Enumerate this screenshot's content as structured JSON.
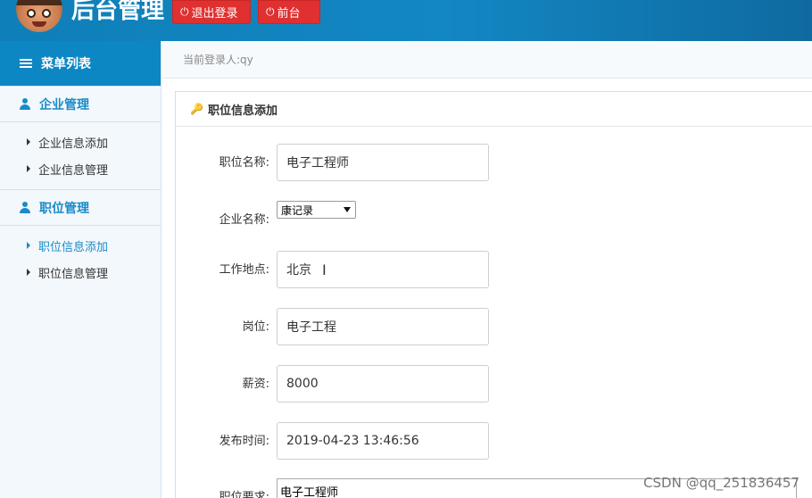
{
  "header": {
    "title": "后台管理",
    "logout_label": "退出登录",
    "front_label": "前台",
    "power_icon": "power-icon"
  },
  "sidebar": {
    "menu_title": "菜单列表",
    "groups": [
      {
        "label": "企业管理",
        "items": [
          "企业信息添加",
          "企业信息管理"
        ]
      },
      {
        "label": "职位管理",
        "items": [
          "职位信息添加",
          "职位信息管理"
        ]
      }
    ],
    "active_item": "职位信息添加"
  },
  "breadcrumb": "当前登录人:qy",
  "panel": {
    "title": "职位信息添加",
    "fields": {
      "position_name": {
        "label": "职位名称:",
        "value": "电子工程师"
      },
      "company_name": {
        "label": "企业名称:",
        "value": "康记录"
      },
      "work_location": {
        "label": "工作地点:",
        "value": "北京"
      },
      "post": {
        "label": "岗位:",
        "value": "电子工程"
      },
      "salary": {
        "label": "薪资:",
        "value": "8000"
      },
      "publish_time": {
        "label": "发布时间:",
        "value": "2019-04-23 13:46:56"
      },
      "requirements": {
        "label": "职位要求:",
        "value": "电子工程师"
      }
    }
  },
  "watermark": "CSDN @qq_251836457",
  "colors": {
    "header": "#1387c3",
    "accent": "#1a8ac8",
    "button_red": "#e03030"
  }
}
